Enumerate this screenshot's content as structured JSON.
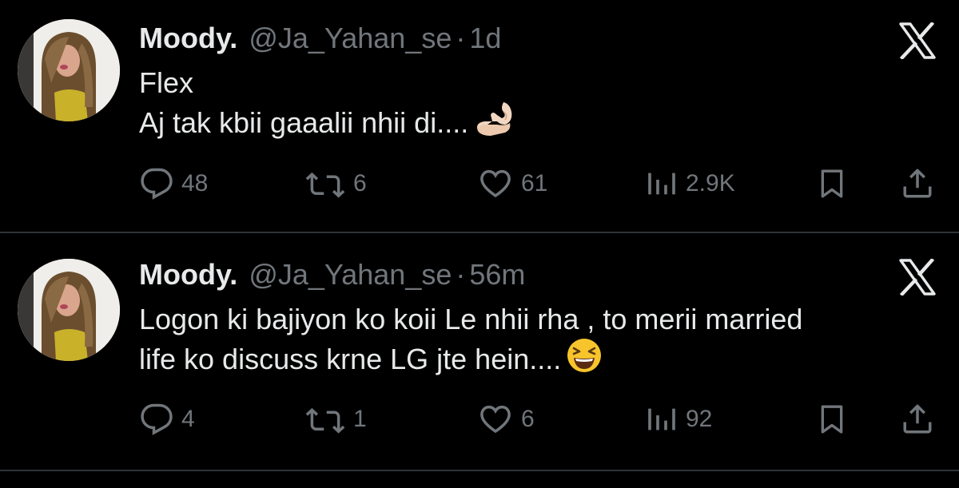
{
  "tweets": [
    {
      "author_name": "Moody.",
      "handle": "@Ja_Yahan_se",
      "separator": "·",
      "time": "1d",
      "text_lines": [
        "Flex",
        "Aj tak kbii gaaalii nhii di...."
      ],
      "emoji": "ok-hand-emoji",
      "replies": "48",
      "retweets": "6",
      "likes": "61",
      "views": "2.9K"
    },
    {
      "author_name": "Moody.",
      "handle": "@Ja_Yahan_se",
      "separator": "·",
      "time": "56m",
      "text_lines": [
        "Logon ki bajiyon ko koii Le nhii rha , to merii married",
        "life ko discuss krne LG jte hein...."
      ],
      "emoji": "grinning-squinting-face-emoji",
      "replies": "4",
      "retweets": "1",
      "likes": "6",
      "views": "92"
    }
  ],
  "colors": {
    "background": "#000000",
    "primary_text": "#e7e9ea",
    "secondary_text": "#71767b",
    "divider": "#2f3336"
  }
}
